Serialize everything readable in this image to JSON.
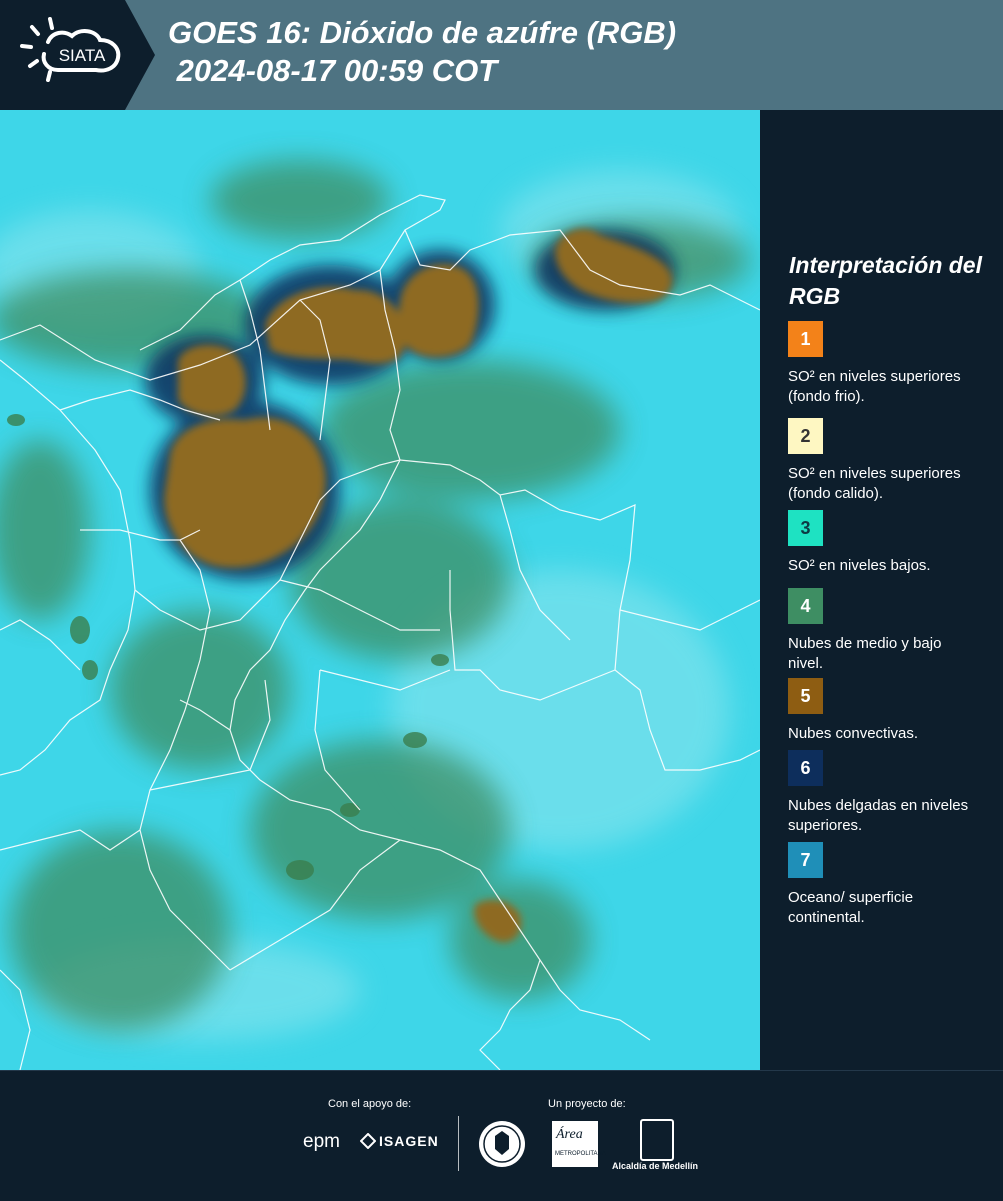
{
  "header": {
    "logo_text": "SIATA",
    "title_line1": "GOES 16: Dióxido de azúfre (RGB)",
    "title_line2": " 2024-08-17 00:59 COT"
  },
  "legend": {
    "title": "Interpretación del RGB",
    "items": [
      {
        "number": "1",
        "color": "#f38219",
        "text": "SO² en niveles superiores (fondo frio)."
      },
      {
        "number": "2",
        "color": "#fef7c2",
        "text": "SO² en niveles superiores (fondo calido)."
      },
      {
        "number": "3",
        "color": "#1ee2c2",
        "text": "SO² en niveles bajos."
      },
      {
        "number": "4",
        "color": "#3e8e63",
        "text": "Nubes de medio y bajo nivel."
      },
      {
        "number": "5",
        "color": "#8e5d12",
        "text": "Nubes convectivas."
      },
      {
        "number": "6",
        "color": "#0d2e5c",
        "text": "Nubes delgadas en niveles superiores."
      },
      {
        "number": "7",
        "color": "#1f8fb8",
        "text": "Oceano/ superficie continental."
      }
    ]
  },
  "footer": {
    "support_label": "Con el apoyo de:",
    "project_label": "Un proyecto de:",
    "partners": [
      "epm",
      "ISAGEN",
      "Área Metropolitana Valle de Aburrá",
      "Alcaldía de Medellín"
    ],
    "area_sub": "METROPOLITANA"
  },
  "colors": {
    "header_bg": "#4e7382",
    "page_bg": "#0d1e2c",
    "map_base": "#3ed6e8",
    "convective_cloud": "#8e5d12",
    "mid_low_cloud": "#3e8e63"
  }
}
